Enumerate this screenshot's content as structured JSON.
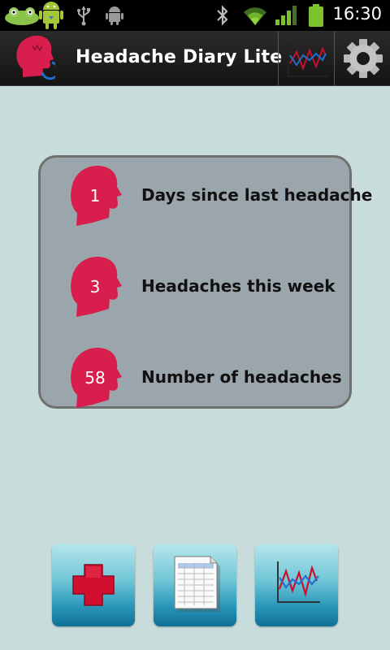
{
  "status_bar": {
    "time": "16:30",
    "icons": [
      "frog-notification-icon",
      "android-notification-icon",
      "usb-icon",
      "android-debug-icon",
      "bluetooth-icon",
      "wifi-icon",
      "signal-icon",
      "battery-icon"
    ]
  },
  "action_bar": {
    "app_icon": "head-logo-icon",
    "title": "Headache Diary Lite",
    "actions": [
      "chart-icon",
      "gear-icon"
    ]
  },
  "stats": [
    {
      "value": "1",
      "label": "Days since last headache"
    },
    {
      "value": "3",
      "label": "Headaches this week"
    },
    {
      "value": "58",
      "label": "Number of headaches"
    }
  ],
  "bottom_buttons": [
    "add-headache-button",
    "report-button",
    "chart-button"
  ],
  "colors": {
    "background": "#c9dcdc",
    "head_red": "#d81e4c",
    "panel": "#9aa6ac",
    "button_blue": "#2a98bb"
  }
}
